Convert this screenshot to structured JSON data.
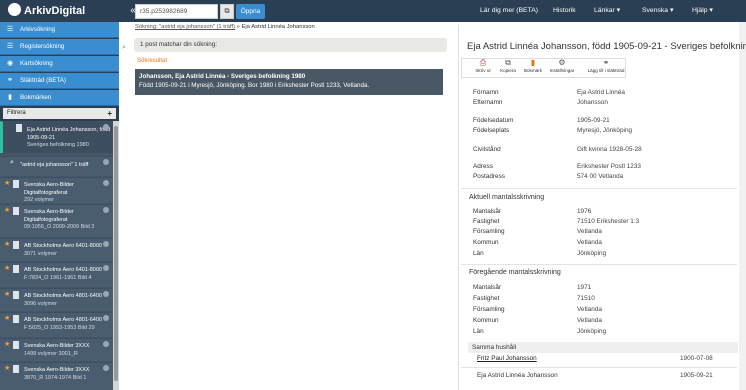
{
  "brand": {
    "name": "ArkivDigital"
  },
  "top": {
    "collapse": "«",
    "search_value": "r35.p253982689",
    "open_label": "Öppna",
    "nav": [
      "Lär dig mer (BETA)",
      "Historik",
      "Länkar ▾",
      "Svenska ▾",
      "Hjälp ▾"
    ]
  },
  "breadcrumb": {
    "link": "Sökning: \"astrid eja johansson\" (1 träff)",
    "sep": "»",
    "current": "Eja Astrid Linnéa Johansson"
  },
  "sidebar": {
    "items": [
      {
        "label": "Arkivsökning",
        "icon": "list-icon",
        "glyph": "☰"
      },
      {
        "label": "Registersökning",
        "icon": "list-icon",
        "glyph": "☰"
      },
      {
        "label": "Kartsökning",
        "icon": "map-pin-icon",
        "glyph": "◉"
      },
      {
        "label": "Släktträd (BETA)",
        "icon": "tree-icon",
        "glyph": "⚭"
      },
      {
        "label": "Bokmärken",
        "icon": "bookmark-icon",
        "glyph": "▮"
      }
    ],
    "filter_label": "Filtrera",
    "filter_plus": "+",
    "history": [
      {
        "title": "Eja Astrid Linnéa Johansson, född 1905-09-21",
        "sub": "Sveriges befolkning 1980",
        "kind": "doc"
      },
      {
        "title": "\"astrid eja johansson\" 1 träff",
        "sub": "",
        "kind": "search"
      },
      {
        "title": "Svenska Aero-Bilder Digitalfotograferat",
        "sub": "292 volymer",
        "kind": "star"
      },
      {
        "title": "Svenska Aero-Bilder Digitalfotograferat",
        "sub": "09:1056_O 2009-2009 Bild 3",
        "kind": "star"
      },
      {
        "title": "AB Stockholms Aero 6401-8000",
        "sub": "3071 volymer",
        "kind": "star"
      },
      {
        "title": "AB Stockholms Aero 6401-8000",
        "sub": "F:7834_O 1961-1961 Bild 4",
        "kind": "star"
      },
      {
        "title": "AB Stockholms Aero 4801-6400",
        "sub": "3096 volymer",
        "kind": "star"
      },
      {
        "title": "AB Stockholms Aero 4801-6400",
        "sub": "F:5025_O 1953-1953 Bild 29",
        "kind": "star"
      },
      {
        "title": "Svenska Aero-Bilder 3XXX",
        "sub": "1499 volymer 3001_R",
        "kind": "star"
      },
      {
        "title": "Svenska Aero-Bilder 3XXX",
        "sub": "3870_R 1974-1974 Bild 1",
        "kind": "star"
      }
    ]
  },
  "results": {
    "match_text": "1 post matchar din sökning:",
    "section_label": "Sökresultat",
    "row_title": "Johansson, Eja Astrid Linnéa - Sveriges befolkning 1980",
    "row_sub": "Född 1905-09-21 i Myresjö, Jönköping. Bor 1980 i Erikshester Postl 1233, Vetlanda."
  },
  "detail": {
    "title": "Eja Astrid Linnéa Johansson, född 1905-09-21 - Sveriges befolkning 1980",
    "tools": [
      {
        "label": "Skriv ut",
        "icon": "print-icon",
        "glyph": "⎙"
      },
      {
        "label": "Kopiera",
        "icon": "copy-icon",
        "glyph": "⧉"
      },
      {
        "label": "Bokmärk",
        "icon": "bookmark-icon",
        "glyph": "▮"
      },
      {
        "label": "Inställningar",
        "icon": "gear-icon",
        "glyph": "⚙"
      },
      {
        "label": "Lägg till i släktträd",
        "icon": "tree-icon",
        "glyph": "⚭"
      }
    ],
    "fields": [
      {
        "label": "Förnamn",
        "value": "Eja Astrid Linnéa"
      },
      {
        "label": "Efternamn",
        "value": "Johansson"
      },
      {
        "label": "Födelsedatum",
        "value": "1905-09-21"
      },
      {
        "label": "Födelseplats",
        "value": "Myresjö, Jönköping"
      },
      {
        "label": "Civilstånd",
        "value": "Gift kvinna 1928-05-28"
      },
      {
        "label": "Adress",
        "value": "Erikshester Postl 1233"
      },
      {
        "label": "Postadress",
        "value": "574 00 Vetlanda"
      }
    ],
    "current_header": "Aktuell mantalsskrivning",
    "current": [
      {
        "label": "Mantalsår",
        "value": "1976"
      },
      {
        "label": "Fastighet",
        "value": "71510 Erikshester 1:3"
      },
      {
        "label": "Församling",
        "value": "Vetlanda"
      },
      {
        "label": "Kommun",
        "value": "Vetlanda"
      },
      {
        "label": "Län",
        "value": "Jönköping"
      }
    ],
    "previous_header": "Föregående mantalsskrivning",
    "previous": [
      {
        "label": "Mantalsår",
        "value": "1971"
      },
      {
        "label": "Fastighet",
        "value": "71510"
      },
      {
        "label": "Församling",
        "value": "Vetlanda"
      },
      {
        "label": "Kommun",
        "value": "Vetlanda"
      },
      {
        "label": "Län",
        "value": "Jönköping"
      }
    ],
    "household_header": "Samma hushåll",
    "household": [
      {
        "name": "Fritz Paul Johansson",
        "year": "1900-07-08"
      },
      {
        "name": "Eja Astrid Linnéa Johansson",
        "year": "1905-09-21"
      }
    ]
  }
}
